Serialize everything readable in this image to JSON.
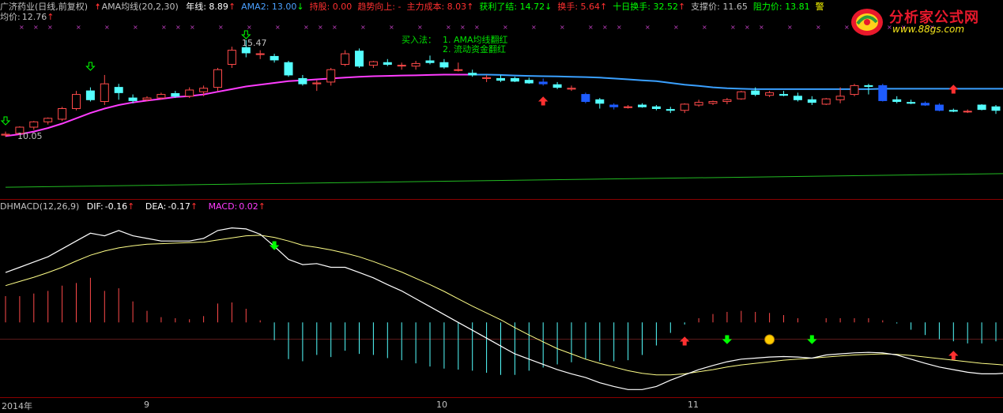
{
  "header": {
    "stock": "广济药业(日线,前复权)",
    "indicator": "AMA均线(20,2,30)",
    "items": [
      {
        "label": "年线",
        "value": "8.89",
        "color": "#ffffff",
        "arrow": "↑",
        "arrow_color": "#ff3030"
      },
      {
        "label": "AMA2",
        "value": "13.00",
        "color": "#4aa0ff",
        "arrow": "↓",
        "arrow_color": "#00ff00"
      },
      {
        "label": "持股",
        "value": "0.00",
        "color": "#ff3030",
        "arrow": "",
        "arrow_color": ""
      },
      {
        "label": "趋势向上",
        "value": "-",
        "color": "#ff3030",
        "arrow": "",
        "arrow_color": ""
      },
      {
        "label": "主力成本",
        "value": "8.03",
        "color": "#ff3030",
        "arrow": "↑",
        "arrow_color": "#ff3030"
      },
      {
        "label": "获利了结",
        "value": "14.72",
        "color": "#00ff00",
        "arrow": "↓",
        "arrow_color": "#00ff00"
      },
      {
        "label": "换手",
        "value": "5.64",
        "color": "#ff3030",
        "arrow": "↑",
        "arrow_color": "#ff3030"
      },
      {
        "label": "十日换手",
        "value": "32.52",
        "color": "#00ff00",
        "arrow": "↑",
        "arrow_color": "#ff3030"
      },
      {
        "label": "支撑价",
        "value": "11.65",
        "color": "#c0c0c0",
        "arrow": "",
        "arrow_color": ""
      },
      {
        "label": "阻力价",
        "value": "13.81",
        "color": "#00ff00",
        "arrow": "",
        "arrow_color": ""
      },
      {
        "label": "警",
        "value": "",
        "color": "#ffff00",
        "arrow": "",
        "arrow_color": ""
      }
    ],
    "avg_label": "均价",
    "avg_value": "12.76",
    "avg_arrow": "↑"
  },
  "annotations": {
    "buy_method_title": "买入法：",
    "buy_method_1": "1. AMA均线翻红",
    "buy_method_2": "2. 流动资金翻红",
    "high_label": "15.47",
    "low_label": "10.05"
  },
  "macd_header": {
    "name": "DHMACD(12,26,9)",
    "dif_label": "DIF",
    "dif_value": "-0.16",
    "dea_label": "DEA",
    "dea_value": "-0.17",
    "macd_label": "MACD",
    "macd_value": "0.02"
  },
  "x_axis": [
    "2014年",
    "9",
    "10",
    "11"
  ],
  "logo": {
    "brand": "分析家公式网",
    "url": "www.88gs.com"
  },
  "colors": {
    "up": "#ff4a4a",
    "down": "#54ffff",
    "down_blue": "#1e5cff",
    "ama_up": "#ff3cff",
    "ama_down": "#3aa0ff",
    "year_line": "#22bb22",
    "dif": "#ffffff",
    "dea": "#ffff88",
    "macd_pos": "#ff4a4a",
    "macd_neg": "#54ffff",
    "grid": "#8a0000"
  },
  "chart_data": [
    {
      "type": "candlestick",
      "title": "广济药业(日线,前复权)",
      "series_names": [
        "AMA均线",
        "年线"
      ],
      "candles": [
        {
          "o": 10.1,
          "h": 10.3,
          "l": 10.0,
          "c": 10.15
        },
        {
          "o": 10.2,
          "h": 10.6,
          "l": 10.1,
          "c": 10.55
        },
        {
          "o": 10.55,
          "h": 10.9,
          "l": 10.4,
          "c": 10.85
        },
        {
          "o": 10.85,
          "h": 11.1,
          "l": 10.7,
          "c": 11.05
        },
        {
          "o": 11.0,
          "h": 11.7,
          "l": 10.9,
          "c": 11.6
        },
        {
          "o": 11.6,
          "h": 12.6,
          "l": 11.5,
          "c": 12.4
        },
        {
          "o": 12.6,
          "h": 12.8,
          "l": 12.0,
          "c": 12.1
        },
        {
          "o": 12.0,
          "h": 13.5,
          "l": 11.8,
          "c": 13.0
        },
        {
          "o": 12.8,
          "h": 13.0,
          "l": 12.1,
          "c": 12.5
        },
        {
          "o": 12.2,
          "h": 12.4,
          "l": 11.9,
          "c": 12.05
        },
        {
          "o": 12.1,
          "h": 12.3,
          "l": 12.0,
          "c": 12.2
        },
        {
          "o": 12.2,
          "h": 12.5,
          "l": 12.1,
          "c": 12.4
        },
        {
          "o": 12.45,
          "h": 12.6,
          "l": 12.2,
          "c": 12.3
        },
        {
          "o": 12.3,
          "h": 12.8,
          "l": 12.2,
          "c": 12.65
        },
        {
          "o": 12.55,
          "h": 12.9,
          "l": 12.3,
          "c": 12.75
        },
        {
          "o": 12.8,
          "h": 13.9,
          "l": 12.6,
          "c": 13.8
        },
        {
          "o": 14.1,
          "h": 15.1,
          "l": 13.9,
          "c": 14.9
        },
        {
          "o": 15.05,
          "h": 15.47,
          "l": 14.5,
          "c": 14.75
        },
        {
          "o": 14.7,
          "h": 14.9,
          "l": 14.4,
          "c": 14.7
        },
        {
          "o": 14.55,
          "h": 14.7,
          "l": 14.2,
          "c": 14.35
        },
        {
          "o": 14.2,
          "h": 14.3,
          "l": 13.4,
          "c": 13.5
        },
        {
          "o": 13.3,
          "h": 13.5,
          "l": 12.9,
          "c": 13.0
        },
        {
          "o": 13.0,
          "h": 13.2,
          "l": 12.6,
          "c": 13.05
        },
        {
          "o": 13.1,
          "h": 13.9,
          "l": 12.9,
          "c": 13.8
        },
        {
          "o": 14.1,
          "h": 14.9,
          "l": 14.0,
          "c": 14.7
        },
        {
          "o": 14.85,
          "h": 15.0,
          "l": 13.9,
          "c": 14.0
        },
        {
          "o": 14.05,
          "h": 14.3,
          "l": 13.9,
          "c": 14.25
        },
        {
          "o": 14.2,
          "h": 14.4,
          "l": 14.0,
          "c": 14.1
        },
        {
          "o": 14.05,
          "h": 14.2,
          "l": 13.8,
          "c": 14.05
        },
        {
          "o": 14.0,
          "h": 14.3,
          "l": 13.8,
          "c": 14.15
        },
        {
          "o": 14.3,
          "h": 14.6,
          "l": 14.1,
          "c": 14.2
        },
        {
          "o": 14.2,
          "h": 14.4,
          "l": 13.85,
          "c": 13.95
        },
        {
          "o": 13.8,
          "h": 14.2,
          "l": 13.7,
          "c": 13.8
        },
        {
          "o": 13.6,
          "h": 13.8,
          "l": 13.4,
          "c": 13.5
        },
        {
          "o": 13.3,
          "h": 13.5,
          "l": 13.1,
          "c": 13.35
        },
        {
          "o": 13.3,
          "h": 13.5,
          "l": 13.1,
          "c": 13.2
        },
        {
          "o": 13.3,
          "h": 13.4,
          "l": 13.1,
          "c": 13.15
        },
        {
          "o": 13.2,
          "h": 13.35,
          "l": 13.0,
          "c": 13.05
        },
        {
          "o": 13.1,
          "h": 13.3,
          "l": 12.9,
          "c": 13.0
        },
        {
          "o": 12.95,
          "h": 13.1,
          "l": 12.7,
          "c": 12.8
        },
        {
          "o": 12.7,
          "h": 12.9,
          "l": 12.6,
          "c": 12.75
        },
        {
          "o": 12.4,
          "h": 12.5,
          "l": 11.9,
          "c": 12.0
        },
        {
          "o": 12.1,
          "h": 12.2,
          "l": 11.6,
          "c": 11.9
        },
        {
          "o": 11.8,
          "h": 11.9,
          "l": 11.55,
          "c": 11.7
        },
        {
          "o": 11.7,
          "h": 11.8,
          "l": 11.6,
          "c": 11.7
        },
        {
          "o": 11.8,
          "h": 11.9,
          "l": 11.65,
          "c": 11.7
        },
        {
          "o": 11.7,
          "h": 11.8,
          "l": 11.5,
          "c": 11.6
        },
        {
          "o": 11.55,
          "h": 11.7,
          "l": 11.35,
          "c": 11.5
        },
        {
          "o": 11.5,
          "h": 11.9,
          "l": 11.35,
          "c": 11.85
        },
        {
          "o": 11.8,
          "h": 12.1,
          "l": 11.7,
          "c": 11.95
        },
        {
          "o": 11.9,
          "h": 12.05,
          "l": 11.8,
          "c": 12.0
        },
        {
          "o": 12.0,
          "h": 12.2,
          "l": 11.85,
          "c": 12.1
        },
        {
          "o": 12.15,
          "h": 12.6,
          "l": 12.1,
          "c": 12.55
        },
        {
          "o": 12.6,
          "h": 12.8,
          "l": 12.3,
          "c": 12.4
        },
        {
          "o": 12.35,
          "h": 12.6,
          "l": 12.25,
          "c": 12.5
        },
        {
          "o": 12.4,
          "h": 12.6,
          "l": 12.3,
          "c": 12.35
        },
        {
          "o": 12.3,
          "h": 12.5,
          "l": 12.0,
          "c": 12.1
        },
        {
          "o": 12.1,
          "h": 12.3,
          "l": 11.8,
          "c": 11.95
        },
        {
          "o": 11.85,
          "h": 12.2,
          "l": 11.8,
          "c": 12.15
        },
        {
          "o": 12.1,
          "h": 12.8,
          "l": 11.9,
          "c": 12.3
        },
        {
          "o": 12.4,
          "h": 13.0,
          "l": 12.3,
          "c": 12.9
        },
        {
          "o": 12.9,
          "h": 13.0,
          "l": 12.4,
          "c": 12.85
        },
        {
          "o": 12.9,
          "h": 13.0,
          "l": 12.0,
          "c": 12.05
        },
        {
          "o": 12.1,
          "h": 12.3,
          "l": 11.9,
          "c": 12.0
        },
        {
          "o": 11.95,
          "h": 12.1,
          "l": 11.85,
          "c": 11.9
        },
        {
          "o": 11.9,
          "h": 12.0,
          "l": 11.75,
          "c": 11.8
        },
        {
          "o": 11.8,
          "h": 11.9,
          "l": 11.45,
          "c": 11.5
        },
        {
          "o": 11.5,
          "h": 11.6,
          "l": 11.4,
          "c": 11.45
        },
        {
          "o": 11.45,
          "h": 11.55,
          "l": 11.35,
          "c": 11.45
        },
        {
          "o": 11.8,
          "h": 11.85,
          "l": 11.5,
          "c": 11.55
        },
        {
          "o": 11.7,
          "h": 11.8,
          "l": 11.3,
          "c": 11.5
        },
        {
          "o": 11.4,
          "h": 11.6,
          "l": 11.1,
          "c": 11.5
        },
        {
          "o": 11.55,
          "h": 12.1,
          "l": 11.5,
          "c": 11.95
        },
        {
          "o": 11.8,
          "h": 12.1,
          "l": 11.6,
          "c": 11.95
        }
      ],
      "ama": [
        10.05,
        10.15,
        10.3,
        10.5,
        10.75,
        11.05,
        11.35,
        11.6,
        11.8,
        11.95,
        12.05,
        12.15,
        12.25,
        12.3,
        12.4,
        12.55,
        12.7,
        12.85,
        12.95,
        13.05,
        13.15,
        13.2,
        13.25,
        13.3,
        13.35,
        13.4,
        13.43,
        13.45,
        13.47,
        13.48,
        13.5,
        13.52,
        13.52,
        13.52,
        13.52,
        13.5,
        13.47,
        13.45,
        13.43,
        13.42,
        13.4,
        13.38,
        13.35,
        13.3,
        13.25,
        13.2,
        13.15,
        13.05,
        12.95,
        12.88,
        12.8,
        12.75,
        12.72,
        12.7,
        12.7,
        12.7,
        12.7,
        12.7,
        12.7,
        12.7,
        12.7,
        12.7,
        12.72,
        12.72,
        12.72,
        12.72,
        12.72,
        12.72,
        12.72,
        12.72,
        12.72,
        12.72,
        12.72,
        12.72
      ],
      "ama_color_switch_index": 33,
      "year_line_start": 7.15,
      "year_line_end": 7.95,
      "y_range": [
        6.8,
        16.4
      ]
    },
    {
      "type": "line+bar",
      "title": "DHMACD(12,26,9)",
      "series_names": [
        "DIF",
        "DEA",
        "MACD"
      ],
      "dif": [
        0.95,
        1.05,
        1.15,
        1.25,
        1.4,
        1.55,
        1.7,
        1.65,
        1.75,
        1.65,
        1.6,
        1.55,
        1.55,
        1.55,
        1.6,
        1.75,
        1.8,
        1.78,
        1.68,
        1.45,
        1.2,
        1.1,
        1.12,
        1.05,
        1.05,
        0.95,
        0.85,
        0.72,
        0.6,
        0.45,
        0.3,
        0.15,
        0.0,
        -0.15,
        -0.3,
        -0.45,
        -0.6,
        -0.7,
        -0.8,
        -0.9,
        -0.98,
        -1.05,
        -1.15,
        -1.22,
        -1.28,
        -1.28,
        -1.22,
        -1.1,
        -1.0,
        -0.9,
        -0.82,
        -0.75,
        -0.7,
        -0.68,
        -0.66,
        -0.65,
        -0.66,
        -0.68,
        -0.62,
        -0.6,
        -0.58,
        -0.57,
        -0.58,
        -0.62,
        -0.7,
        -0.78,
        -0.85,
        -0.9,
        -0.95,
        -0.98,
        -0.98,
        -0.96,
        -0.92,
        -0.87
      ],
      "dea": [
        0.7,
        0.78,
        0.86,
        0.95,
        1.05,
        1.17,
        1.28,
        1.36,
        1.42,
        1.46,
        1.49,
        1.5,
        1.51,
        1.52,
        1.53,
        1.57,
        1.61,
        1.65,
        1.66,
        1.62,
        1.55,
        1.47,
        1.43,
        1.38,
        1.32,
        1.25,
        1.16,
        1.06,
        0.96,
        0.84,
        0.72,
        0.59,
        0.45,
        0.31,
        0.18,
        0.05,
        -0.1,
        -0.24,
        -0.37,
        -0.5,
        -0.6,
        -0.7,
        -0.78,
        -0.85,
        -0.92,
        -0.97,
        -1.0,
        -1.0,
        -0.98,
        -0.94,
        -0.9,
        -0.85,
        -0.81,
        -0.78,
        -0.75,
        -0.72,
        -0.7,
        -0.68,
        -0.66,
        -0.64,
        -0.62,
        -0.61,
        -0.6,
        -0.61,
        -0.63,
        -0.66,
        -0.69,
        -0.72,
        -0.75,
        -0.78,
        -0.8,
        -0.82,
        -0.84,
        -0.86
      ],
      "macd": [
        0.5,
        0.5,
        0.55,
        0.6,
        0.7,
        0.75,
        0.85,
        0.6,
        0.65,
        0.4,
        0.22,
        0.1,
        0.08,
        0.06,
        0.12,
        0.36,
        0.38,
        0.26,
        0.04,
        -0.34,
        -0.7,
        -0.74,
        -0.62,
        -0.66,
        -0.54,
        -0.6,
        -0.62,
        -0.68,
        -0.72,
        -0.78,
        -0.84,
        -0.88,
        -0.9,
        -0.92,
        -0.96,
        -1.0,
        -1.0,
        -0.92,
        -0.86,
        -0.8,
        -0.76,
        -0.7,
        -0.74,
        -0.74,
        -0.72,
        -0.62,
        -0.44,
        -0.2,
        -0.04,
        0.08,
        0.16,
        0.2,
        0.22,
        0.2,
        0.18,
        0.14,
        0.08,
        0.0,
        0.08,
        0.08,
        0.08,
        0.08,
        0.04,
        -0.02,
        -0.14,
        -0.24,
        -0.32,
        -0.36,
        -0.4,
        -0.4,
        -0.36,
        -0.28,
        -0.16,
        0.02
      ],
      "y_range": [
        -1.35,
        2.05
      ]
    }
  ]
}
